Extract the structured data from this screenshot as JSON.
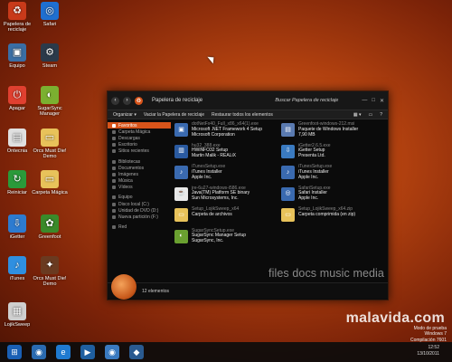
{
  "desktop": {
    "icons": [
      {
        "label": "Papelera de reciclaje",
        "icon": "recycle-bin-icon",
        "color": "#c83a1a",
        "glyph": "♻"
      },
      {
        "label": "Safari",
        "icon": "safari-icon",
        "color": "#1f6fd0",
        "glyph": "◎"
      },
      {
        "label": "Equipo",
        "icon": "computer-icon",
        "color": "#3a6ea5",
        "glyph": "▣"
      },
      {
        "label": "Steam",
        "icon": "steam-icon",
        "color": "#2b3a4a",
        "glyph": "⚙"
      },
      {
        "label": "Apagar",
        "icon": "power-icon",
        "color": "#e04030",
        "glyph": "⏻"
      },
      {
        "label": "SugarSync Manager",
        "icon": "sugarsync-icon",
        "color": "#7bb030",
        "glyph": "◐"
      },
      {
        "label": "Ontecnia",
        "icon": "document-icon",
        "color": "#e0e0e0",
        "glyph": "▤"
      },
      {
        "label": "Orcs Must Die! Demo",
        "icon": "folder-icon",
        "color": "#e8c25a",
        "glyph": "▭"
      },
      {
        "label": "Reiniciar",
        "icon": "restart-icon",
        "color": "#2a9a3a",
        "glyph": "↻"
      },
      {
        "label": "Carpeta Mágica",
        "icon": "folder-icon",
        "color": "#e8c25a",
        "glyph": "▭"
      },
      {
        "label": "iGetter",
        "icon": "igetter-icon",
        "color": "#2d7bd0",
        "glyph": "⇩"
      },
      {
        "label": "Greenfoot",
        "icon": "greenfoot-icon",
        "color": "#3a8a2a",
        "glyph": "✿"
      },
      {
        "label": "iTunes",
        "icon": "itunes-icon",
        "color": "#2f8fe0",
        "glyph": "♪"
      },
      {
        "label": "Orcs Must Die! Demo",
        "icon": "game-icon",
        "color": "#6a3a20",
        "glyph": "✦"
      },
      {
        "label": "LojikSweep",
        "icon": "lojiksweep-icon",
        "color": "#cfcfcf",
        "glyph": "▦"
      }
    ]
  },
  "window": {
    "path": "Papelera de reciclaje",
    "search_placeholder": "Buscar Papelera de reciclaje",
    "toolbar": {
      "organize": "Organizar ▾",
      "empty": "Vaciar la Papelera de reciclaje",
      "restore": "Restaurar todos los elementos"
    },
    "nav": [
      {
        "label": "Favoritos",
        "selected": true
      },
      {
        "label": "Carpeta Mágica"
      },
      {
        "label": "Descargas"
      },
      {
        "label": "Escritorio"
      },
      {
        "label": "Sitios recientes"
      },
      {
        "label": "Bibliotecas",
        "group": true
      },
      {
        "label": "Documentos"
      },
      {
        "label": "Imágenes"
      },
      {
        "label": "Música"
      },
      {
        "label": "Vídeos"
      },
      {
        "label": "Equipo",
        "group": true
      },
      {
        "label": "Disco local (C:)"
      },
      {
        "label": "Unidad de DVD (D:)"
      },
      {
        "label": "Nueva partición (F:)"
      },
      {
        "label": "Red",
        "group": true
      }
    ],
    "files": [
      {
        "name": "dotNetFx40_Full_x86_x64(1).exe",
        "desc": "Microsoft .NET Framework 4 Setup",
        "sub": "Microsoft Corporation",
        "icon": "installer-icon",
        "color": "#3a6ab0",
        "glyph": "▣"
      },
      {
        "name": "Greenfoot-windows-212.msi",
        "desc": "Paquete de Windows Installer",
        "sub": "7,90 MB",
        "icon": "msi-icon",
        "color": "#5a7ab0",
        "glyph": "▤"
      },
      {
        "name": "hu32_388.exe",
        "desc": "HWiNFO32 Setup",
        "sub": "Martin Malik - REALiX",
        "icon": "hwinfo-icon",
        "color": "#2a5aa0",
        "glyph": "▥"
      },
      {
        "name": "iGetter2.6.5.exe",
        "desc": "iGetter Setup",
        "sub": "Presenta Ltd.",
        "icon": "igetter-setup-icon",
        "color": "#3a7ac0",
        "glyph": "⇩"
      },
      {
        "name": "iTunesSetup.exe",
        "desc": "iTunes Installer",
        "sub": "Apple Inc.",
        "icon": "itunes-setup-icon",
        "color": "#3a6ab0",
        "glyph": "♪"
      },
      {
        "name": "iTunesSetup.exe",
        "desc": "iTunes Installer",
        "sub": "Apple Inc.",
        "icon": "itunes-setup-icon",
        "color": "#3a6ab0",
        "glyph": "♪"
      },
      {
        "name": "jre-6u27-windows-i586.exe",
        "desc": "Java(TM) Platform SE binary",
        "sub": "Sun Microsystems, Inc.",
        "icon": "java-icon",
        "color": "#e8e8e8",
        "glyph": "☕"
      },
      {
        "name": "SafariSetup.exe",
        "desc": "Safari Installer",
        "sub": "Apple Inc.",
        "icon": "safari-setup-icon",
        "color": "#3a6ab0",
        "glyph": "◎"
      },
      {
        "name": "Setup_LojikSweep_x64",
        "desc": "Carpeta de archivos",
        "sub": "",
        "icon": "folder-icon",
        "color": "#e8c25a",
        "glyph": "▭"
      },
      {
        "name": "Setup_LojikSweep_x64.zip",
        "desc": "Carpeta comprimida (en zip)",
        "sub": "",
        "icon": "zip-folder-icon",
        "color": "#e8c25a",
        "glyph": "▭"
      },
      {
        "name": "SugarSyncSetup.exe",
        "desc": "SugarSync Manager Setup",
        "sub": "SugarSync, Inc.",
        "icon": "sugarsync-setup-icon",
        "color": "#6aa030",
        "glyph": "◐"
      }
    ],
    "watermark": "files docs music media",
    "status": "12 elementos"
  },
  "taskbar": {
    "items": [
      {
        "icon": "start-icon",
        "color": "#1a5fb4",
        "glyph": "⊞"
      },
      {
        "icon": "explorer-icon",
        "color": "#2a6ab0",
        "glyph": "◉"
      },
      {
        "icon": "ie-icon",
        "color": "#1f7ad0",
        "glyph": "e"
      },
      {
        "icon": "media-player-icon",
        "color": "#1f5fa0",
        "glyph": "▶"
      },
      {
        "icon": "explorer-icon",
        "color": "#3a7ac0",
        "glyph": "◉"
      },
      {
        "icon": "app-icon",
        "color": "#2a5a90",
        "glyph": "◆"
      }
    ],
    "clock": "12:52",
    "date": "13/10/2011"
  },
  "windows_info": {
    "line1": "Modo de prueba",
    "line2": "Windows 7",
    "line3": "Compilación 7601"
  },
  "brand": "malavida.com"
}
